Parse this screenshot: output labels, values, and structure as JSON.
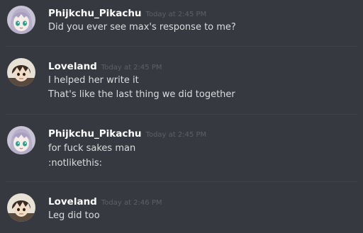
{
  "messages": [
    {
      "username": "Phijkchu_Pikachu",
      "timestamp": "Today at 2:45 PM",
      "avatar": "anime-girl-avatar",
      "lines": [
        "Did you ever see max's response to me?"
      ]
    },
    {
      "username": "Loveland",
      "timestamp": "Today at 2:45 PM",
      "avatar": "dark-haired-boy-avatar",
      "lines": [
        "I helped her write it",
        "That's like the last thing we did together"
      ]
    },
    {
      "username": "Phijkchu_Pikachu",
      "timestamp": "Today at 2:45 PM",
      "avatar": "anime-girl-avatar",
      "lines": [
        "for fuck sakes man",
        ":notlikethis:"
      ]
    },
    {
      "username": "Loveland",
      "timestamp": "Today at 2:46 PM",
      "avatar": "dark-haired-boy-avatar",
      "lines": [
        "Leg did too"
      ]
    }
  ],
  "colors": {
    "background": "#36393f",
    "username": "#ffffff",
    "timestamp": "#5d6067",
    "message_text": "#dcddde",
    "divider": "#40434a"
  }
}
